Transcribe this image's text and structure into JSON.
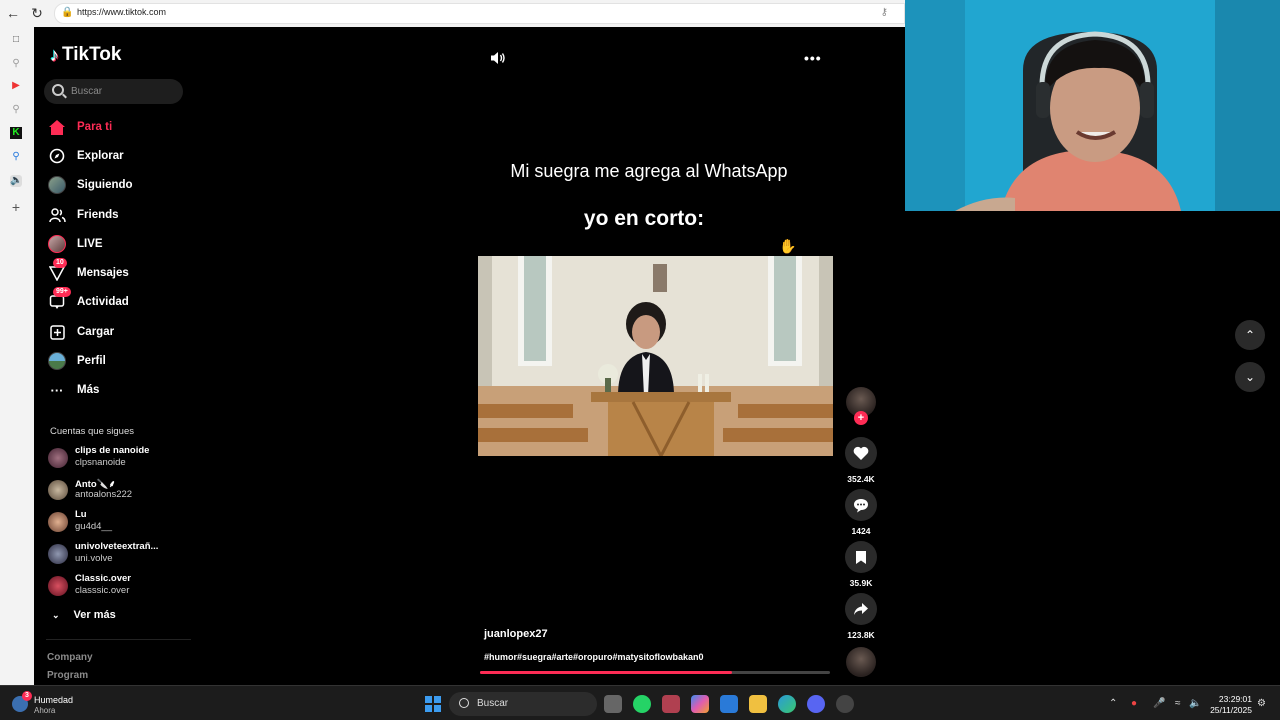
{
  "browser": {
    "url": "https://www.tiktok.com"
  },
  "sidebar": {
    "logo_text": "TikTok",
    "search_placeholder": "Buscar",
    "nav": [
      {
        "label": "Para ti",
        "icon": "home-icon",
        "active": true
      },
      {
        "label": "Explorar",
        "icon": "compass-icon"
      },
      {
        "label": "Siguiendo",
        "icon": "following-avatar-icon"
      },
      {
        "label": "Friends",
        "icon": "friends-icon"
      },
      {
        "label": "LIVE",
        "icon": "live-avatar-icon"
      },
      {
        "label": "Mensajes",
        "icon": "messages-icon",
        "badge": "10"
      },
      {
        "label": "Actividad",
        "icon": "activity-icon",
        "badge": "99+"
      },
      {
        "label": "Cargar",
        "icon": "upload-icon"
      },
      {
        "label": "Perfil",
        "icon": "profile-avatar-icon"
      },
      {
        "label": "Más",
        "icon": "more-dots-icon"
      }
    ],
    "following_title": "Cuentas que sigues",
    "following": [
      {
        "name": "clips de nanoide",
        "handle": "clpsnanoide"
      },
      {
        "name": "Anto🔪⸙",
        "handle": "antoalons222"
      },
      {
        "name": "Lu",
        "handle": "gu4d4__"
      },
      {
        "name": "univolveteextrañ...",
        "handle": "uni.volve"
      },
      {
        "name": "Classic.over",
        "handle": "classsic.over"
      }
    ],
    "see_more": "Ver más",
    "footer": [
      "Company",
      "Program"
    ]
  },
  "video": {
    "caption_line1": "Mi suegra me agrega al WhatsApp",
    "caption_line2": "yo en corto:",
    "author": "juanlopex27",
    "hashtags": "#humor#suegra#arte#oropuro#matysitoflowbakan0",
    "progress": 0.72,
    "likes": "352.4K",
    "comments": "1424",
    "saves": "35.9K",
    "shares": "123.8K"
  },
  "taskbar": {
    "weather_title": "Humedad",
    "weather_sub": "Ahora",
    "weather_badge": "3",
    "search_text": "Buscar",
    "time": "23:29:01",
    "date": "25/11/2025"
  },
  "colors": {
    "accent": "#fe2c55",
    "background": "#000000"
  }
}
